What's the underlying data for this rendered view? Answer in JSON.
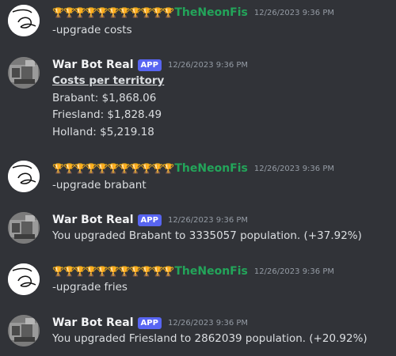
{
  "messages": [
    {
      "author": "TheNeonFis",
      "trophies": "🏆🏆🏆🏆🏆🏆🏆🏆🏆🏆🏆",
      "timestamp": "12/26/2023 9:36 PM",
      "text": "-upgrade costs"
    },
    {
      "author": "War Bot Real",
      "tag": "APP",
      "timestamp": "12/26/2023 9:36 PM",
      "title": "Costs per territory",
      "lines": [
        "Brabant: $1,868.06",
        "Friesland: $1,828.49",
        "Holland: $5,219.18"
      ]
    },
    {
      "author": "TheNeonFis",
      "trophies": "🏆🏆🏆🏆🏆🏆🏆🏆🏆🏆🏆",
      "timestamp": "12/26/2023 9:36 PM",
      "text": "-upgrade brabant"
    },
    {
      "author": "War Bot Real",
      "tag": "APP",
      "timestamp": "12/26/2023 9:36 PM",
      "text": "You upgraded Brabant to 3335057 population. (+37.92%)"
    },
    {
      "author": "TheNeonFis",
      "trophies": "🏆🏆🏆🏆🏆🏆🏆🏆🏆🏆🏆",
      "timestamp": "12/26/2023 9:36 PM",
      "text": "-upgrade fries"
    },
    {
      "author": "War Bot Real",
      "tag": "APP",
      "timestamp": "12/26/2023 9:36 PM",
      "text": "You upgraded Friesland to 2862039 population. (+20.92%)"
    }
  ],
  "colors": {
    "background": "#313338",
    "neon_name": "#23a55a",
    "app_tag": "#5865f2",
    "timestamp": "#949ba4"
  }
}
